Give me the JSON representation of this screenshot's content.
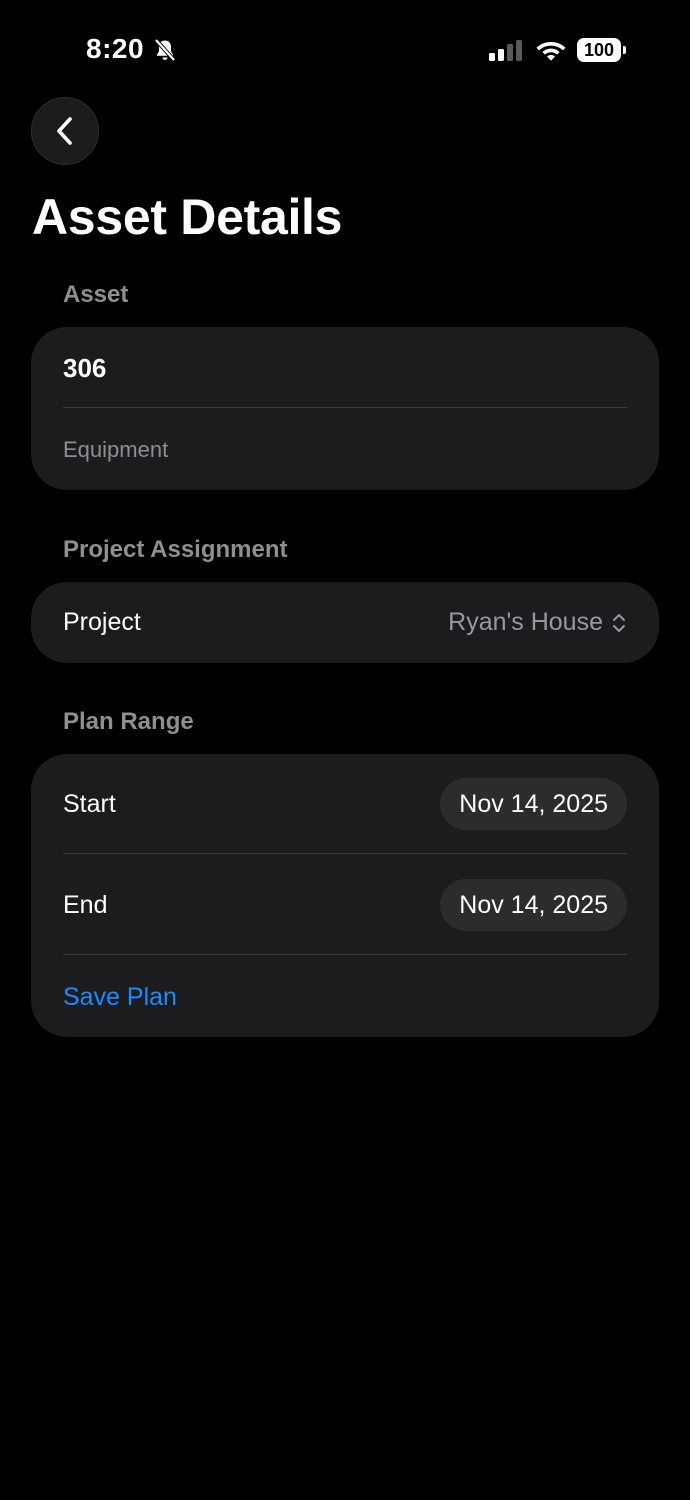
{
  "status_bar": {
    "time": "8:20",
    "battery": "100",
    "icons": [
      "bell-slash-icon",
      "cellular-signal-icon",
      "wifi-icon",
      "battery-icon"
    ]
  },
  "nav": {
    "back_icon": "chevron-left-icon"
  },
  "page": {
    "title": "Asset Details"
  },
  "asset_section": {
    "header": "Asset",
    "name_value": "306",
    "type_placeholder": "Equipment"
  },
  "project_section": {
    "header": "Project Assignment",
    "label": "Project",
    "value": "Ryan's House",
    "picker_icon": "chevron-up-down-icon"
  },
  "plan_section": {
    "header": "Plan Range",
    "start_label": "Start",
    "start_value": "Nov 14, 2025",
    "end_label": "End",
    "end_value": "Nov 14, 2025",
    "save_label": "Save Plan"
  },
  "colors": {
    "background": "#000000",
    "card": "#1c1c1e",
    "pill": "#2c2c2e",
    "secondary_text": "#8e8e93",
    "accent": "#1a8cff"
  }
}
